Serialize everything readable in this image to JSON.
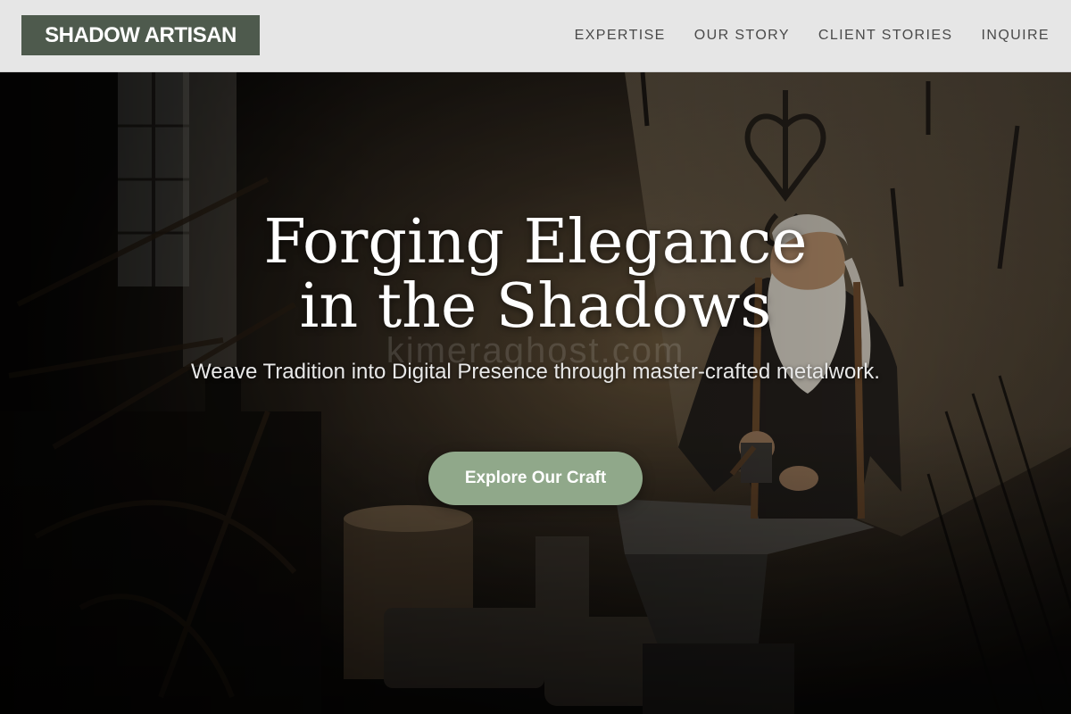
{
  "header": {
    "logo_text": "SHADOW ARTISAN",
    "nav": [
      {
        "label": "EXPERTISE"
      },
      {
        "label": "OUR STORY"
      },
      {
        "label": "CLIENT STORIES"
      },
      {
        "label": "INQUIRE"
      }
    ]
  },
  "hero": {
    "title_line1": "Forging Elegance",
    "title_line2": "in the Shadows",
    "subtitle": "Weave Tradition into Digital Presence through master-crafted metalwork.",
    "cta_label": "Explore Our Craft",
    "watermark": "kimeraghost.com"
  },
  "colors": {
    "header_bg": "#e6e6e6",
    "logo_bg": "#4e5a4d",
    "cta_bg": "#90a88a",
    "nav_text": "#4a4a4a",
    "hero_text": "#ffffff"
  }
}
